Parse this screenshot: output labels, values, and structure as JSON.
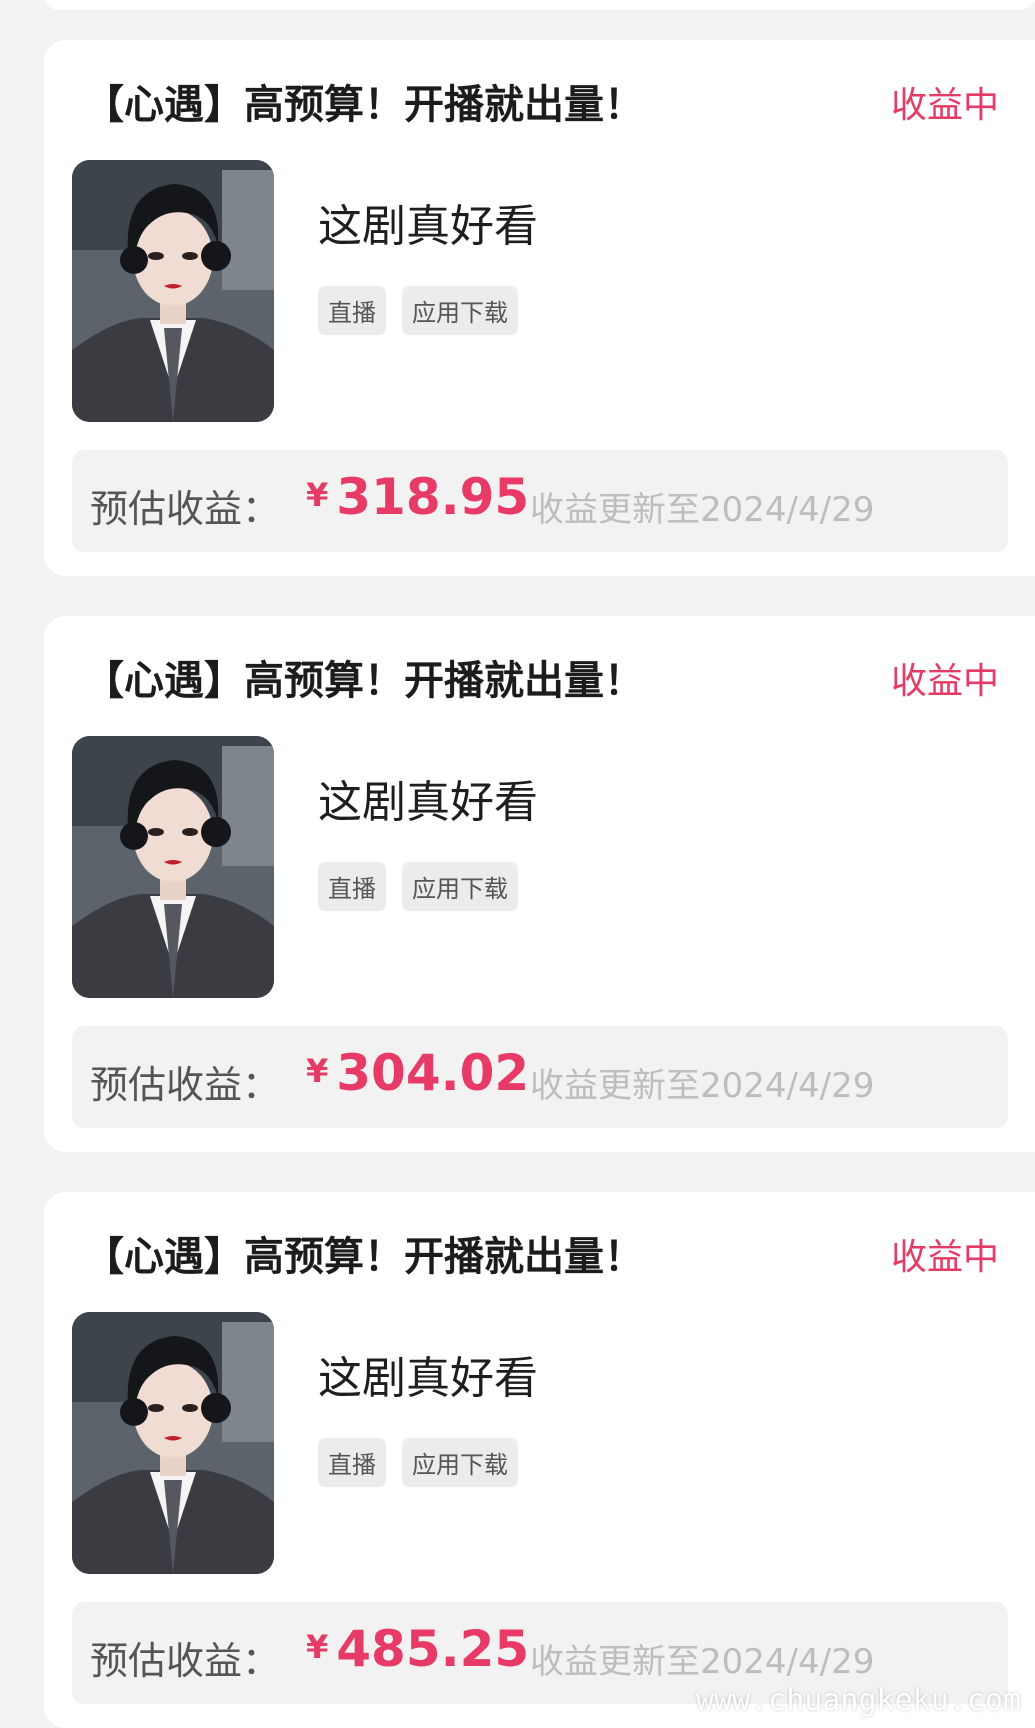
{
  "cards": [
    {
      "title": "【心遇】高预算！开播就出量！",
      "status": "收益中",
      "drama_name": "这剧真好看",
      "tags": [
        "直播",
        "应用下载"
      ],
      "earnings_label": "预估收益：",
      "currency": "¥",
      "amount": "318.95",
      "updated": "收益更新至2024/4/29"
    },
    {
      "title": "【心遇】高预算！开播就出量！",
      "status": "收益中",
      "drama_name": "这剧真好看",
      "tags": [
        "直播",
        "应用下载"
      ],
      "earnings_label": "预估收益：",
      "currency": "¥",
      "amount": "304.02",
      "updated": "收益更新至2024/4/29"
    },
    {
      "title": "【心遇】高预算！开播就出量！",
      "status": "收益中",
      "drama_name": "这剧真好看",
      "tags": [
        "直播",
        "应用下载"
      ],
      "earnings_label": "预估收益：",
      "currency": "¥",
      "amount": "485.25",
      "updated": "收益更新至2024/4/29"
    }
  ],
  "watermark": "www.chuangkeku.com",
  "colors": {
    "accent": "#e83a66",
    "background": "#f3f3f3",
    "card": "#ffffff",
    "earnings_bar": "#f2f2f2",
    "tag_bg": "#ececec",
    "muted_text": "#bdbdbd"
  }
}
